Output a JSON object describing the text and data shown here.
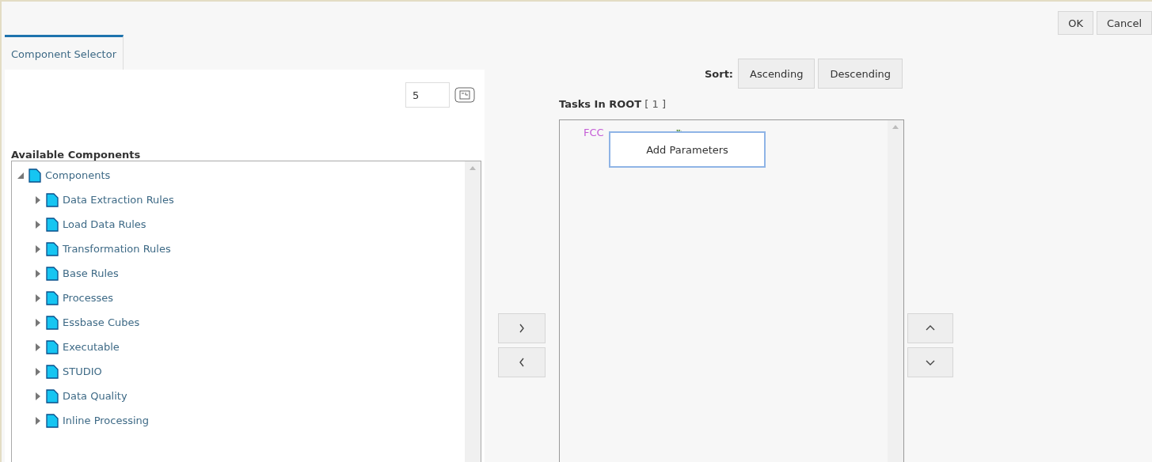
{
  "buttons": [
    "OK",
    "Cancel"
  ],
  "tabs": [
    {
      "label": "Component Selector",
      "selected": true
    }
  ],
  "page_size": {
    "value": "5"
  },
  "available": {
    "title": "Available Components",
    "tree": [
      {
        "label": "Components",
        "expanded": true,
        "children": [
          {
            "label": "Data Extraction Rules",
            "expanded": false
          },
          {
            "label": "Load Data Rules",
            "expanded": false
          },
          {
            "label": "Transformation Rules",
            "expanded": false
          },
          {
            "label": "Base Rules",
            "expanded": false
          },
          {
            "label": "Processes",
            "expanded": false
          },
          {
            "label": "Essbase Cubes",
            "expanded": false
          },
          {
            "label": "Executable",
            "expanded": false
          },
          {
            "label": "STUDIO",
            "expanded": false
          },
          {
            "label": "Data Quality",
            "expanded": false
          },
          {
            "label": "Inline Processing",
            "expanded": false
          }
        ]
      }
    ]
  },
  "sort": {
    "label": "Sort:",
    "buttons": [
      "Ascending",
      "Descending"
    ]
  },
  "tasks": {
    "title": "Tasks In ROOT",
    "count": "[ 1 ]",
    "items": [
      "FCC"
    ]
  },
  "context_menu": {
    "items": [
      "Add Parameters"
    ]
  },
  "move_buttons": [
    {
      "kind": "right"
    },
    {
      "kind": "left"
    }
  ],
  "order_buttons": [
    {
      "kind": "up"
    },
    {
      "kind": "down"
    }
  ]
}
